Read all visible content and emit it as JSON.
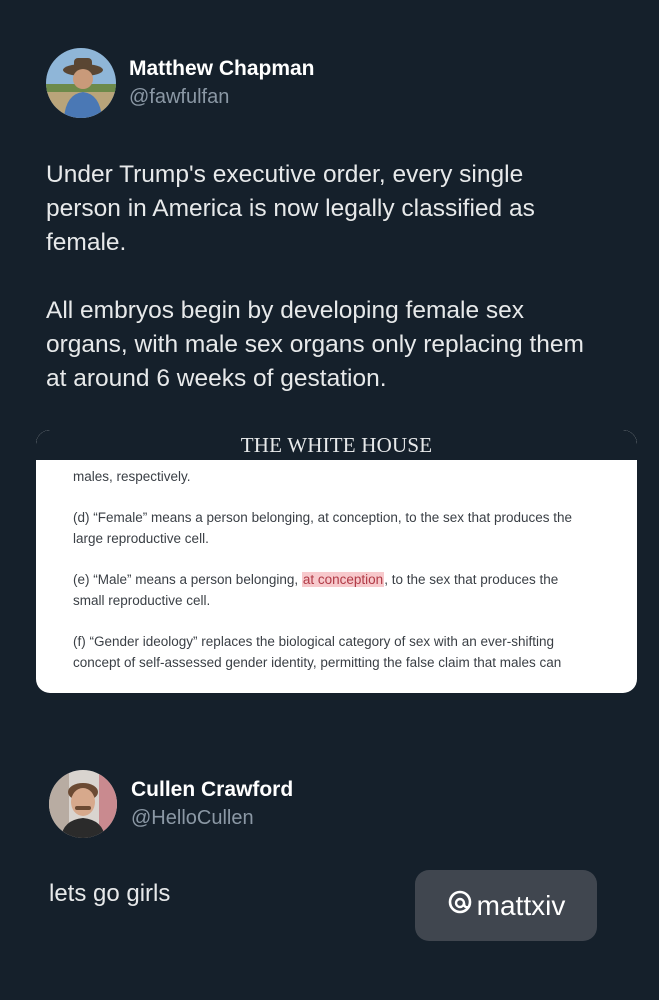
{
  "tweet": {
    "author": {
      "name": "Matthew Chapman",
      "handle": "@fawfulfan",
      "avatar_icon": "avatar-photo"
    },
    "paragraphs": [
      "Under Trump's executive order, every single\nperson in America is now legally classified as\nfemale.",
      "All embryos begin by developing female sex\norgans, with male sex organs only replacing them\nat around 6 weeks of gestation."
    ],
    "attached_image": {
      "banner": "THE WHITE HOUSE",
      "line_top": "males, respectively.",
      "d_line1": "(d) “Female” means a person belonging, at conception, to the sex that produces the",
      "d_line2": "large reproductive cell.",
      "e_before": "(e) “Male” means a person belonging, ",
      "e_highlight": "at conception",
      "e_after": ", to the sex that produces the",
      "e_line2": "small reproductive cell.",
      "f_line1": "(f) “Gender ideology” replaces the biological category of sex with an ever-shifting",
      "f_line2": "concept of self-assessed gender identity, permitting the false claim that males can"
    }
  },
  "reply": {
    "author": {
      "name": "Cullen Crawford",
      "handle": "@HelloCullen",
      "avatar_icon": "avatar-photo"
    },
    "text": "lets go girls"
  },
  "watermark": {
    "text": "mattxiv",
    "icon": "threads-icon"
  },
  "colors": {
    "background": "#15202b",
    "highlight": "#f7c9cc",
    "highlight_text": "#b03a46"
  }
}
